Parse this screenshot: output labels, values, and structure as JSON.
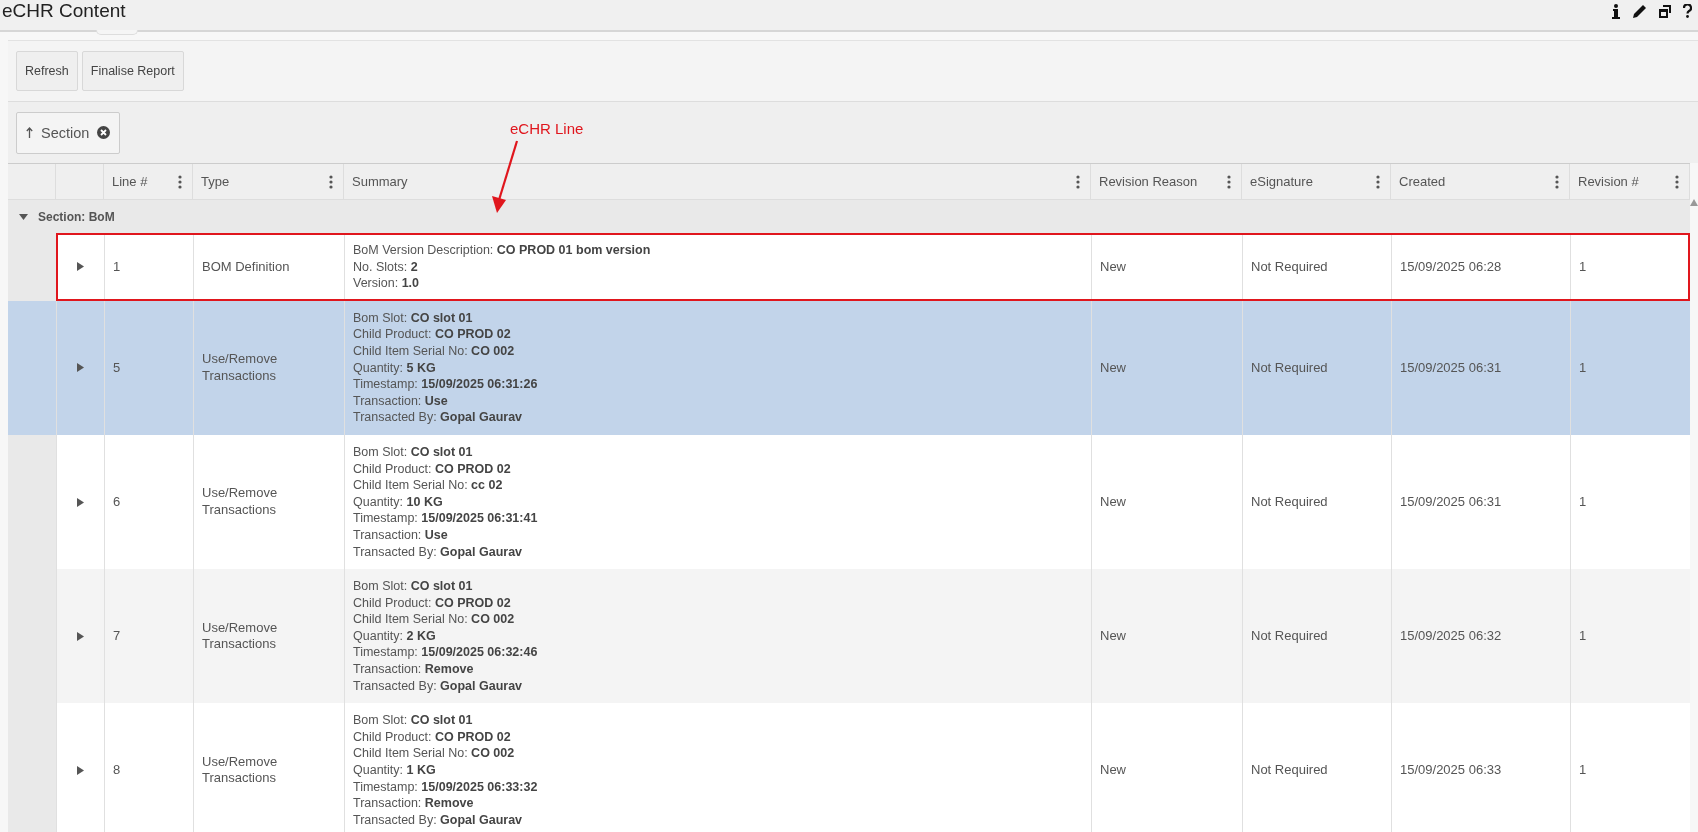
{
  "window": {
    "title": "eCHR Content"
  },
  "toolbar": {
    "buttons": [
      "Refresh",
      "Finalise Report"
    ]
  },
  "group_by": {
    "chips": [
      {
        "label": "Section"
      }
    ]
  },
  "annotation": {
    "label": "eCHR Line"
  },
  "table": {
    "columns": [
      "",
      "",
      "Line #",
      "Type",
      "Summary",
      "Revision Reason",
      "eSignature",
      "Created",
      "Revision #"
    ],
    "group": {
      "label": "Section: BoM",
      "expanded": true
    },
    "rows": [
      {
        "line": "1",
        "type": "BOM Definition",
        "summary": [
          "BoM Version Description: **CO PROD 01 bom version**",
          "No. Slots: **2**",
          "Version: **1.0**"
        ],
        "revision_reason": "New",
        "esignature": "Not Required",
        "created": "15/09/2025 06:28",
        "revision": "1",
        "selected": false,
        "annotated": true
      },
      {
        "line": "5",
        "type": "Use/Remove Transactions",
        "summary": [
          "Bom Slot: **CO slot 01**",
          "Child Product: **CO PROD 02**",
          "Child Item Serial No: **CO 002**",
          "Quantity: **5 KG**",
          "Timestamp: **15/09/2025 06:31:26**",
          "Transaction: **Use**",
          "Transacted By: **Gopal Gaurav**"
        ],
        "revision_reason": "New",
        "esignature": "Not Required",
        "created": "15/09/2025 06:31",
        "revision": "1",
        "selected": true,
        "annotated": false
      },
      {
        "line": "6",
        "type": "Use/Remove Transactions",
        "summary": [
          "Bom Slot: **CO slot 01**",
          "Child Product: **CO PROD 02**",
          "Child Item Serial No: **cc 02**",
          "Quantity: **10 KG**",
          "Timestamp: **15/09/2025 06:31:41**",
          "Transaction: **Use**",
          "Transacted By: **Gopal Gaurav**"
        ],
        "revision_reason": "New",
        "esignature": "Not Required",
        "created": "15/09/2025 06:31",
        "revision": "1",
        "selected": false,
        "annotated": false
      },
      {
        "line": "7",
        "type": "Use/Remove Transactions",
        "summary": [
          "Bom Slot: **CO slot 01**",
          "Child Product: **CO PROD 02**",
          "Child Item Serial No: **CO 002**",
          "Quantity: **2 KG**",
          "Timestamp: **15/09/2025 06:32:46**",
          "Transaction: **Remove**",
          "Transacted By: **Gopal Gaurav**"
        ],
        "revision_reason": "New",
        "esignature": "Not Required",
        "created": "15/09/2025 06:32",
        "revision": "1",
        "selected": false,
        "annotated": false
      },
      {
        "line": "8",
        "type": "Use/Remove Transactions",
        "summary": [
          "Bom Slot: **CO slot 01**",
          "Child Product: **CO PROD 02**",
          "Child Item Serial No: **CO 002**",
          "Quantity: **1 KG**",
          "Timestamp: **15/09/2025 06:33:32**",
          "Transaction: **Remove**",
          "Transacted By: **Gopal Gaurav**"
        ],
        "revision_reason": "New",
        "esignature": "Not Required",
        "created": "15/09/2025 06:33",
        "revision": "1",
        "selected": false,
        "annotated": false
      }
    ]
  }
}
